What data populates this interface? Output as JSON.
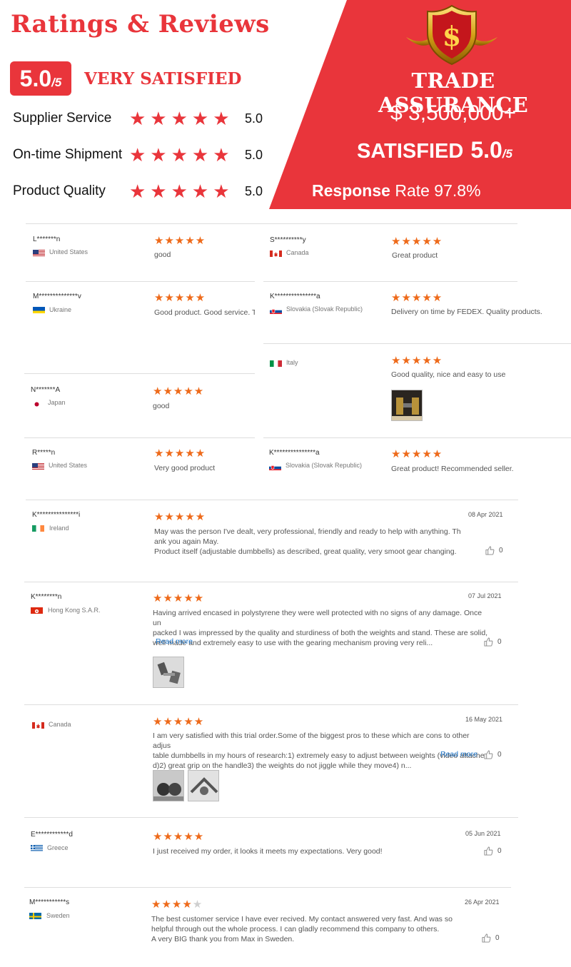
{
  "header": {
    "title": "Ratings & Reviews",
    "score_main": "5.0",
    "score_den": "/5",
    "score_label": "VERY SATISFIED",
    "metrics": [
      {
        "label": "Supplier Service",
        "stars": 5,
        "value": "5.0"
      },
      {
        "label": "On-time Shipment",
        "stars": 5,
        "value": "5.0"
      },
      {
        "label": "Product Quality",
        "stars": 5,
        "value": "5.0"
      }
    ],
    "accent_color": "#e9353b"
  },
  "trade_assurance": {
    "title": "TRADE ASSURANCE",
    "amount": "$ 3,500,000+",
    "satisfied_label": "SATISFIED",
    "satisfied_score": "5.0",
    "satisfied_den": "/5",
    "response_label": "Response",
    "response_rate": "Rate 97.8%",
    "icon": "dollar-shield-icon"
  },
  "reviews": [
    {
      "name": "L*******n",
      "country": "United States",
      "flag": "us",
      "stars": 5,
      "text": "good"
    },
    {
      "name": "S**********y",
      "country": "Canada",
      "flag": "ca",
      "stars": 5,
      "text": "Great product"
    },
    {
      "name": "M**************v",
      "country": "Ukraine",
      "flag": "ua",
      "stars": 5,
      "text": "Good product.  Good service.  T"
    },
    {
      "name": "K***************a",
      "country": "Slovakia (Slovak Republic)",
      "flag": "sk",
      "stars": 5,
      "text": "Delivery on time by FEDEX. Quality products."
    },
    {
      "name": "",
      "country": "Italy",
      "flag": "it",
      "stars": 5,
      "text": "Good quality, nice and easy to use",
      "images": 1
    },
    {
      "name": "N*******A",
      "country": "Japan",
      "flag": "jp",
      "stars": 5,
      "text": "good"
    },
    {
      "name": "R*****n",
      "country": "United States",
      "flag": "us",
      "stars": 5,
      "text": "Very good product"
    },
    {
      "name": "K***************a",
      "country": "Slovakia (Slovak Republic)",
      "flag": "sk",
      "stars": 5,
      "text": "Great product! Recommended seller."
    },
    {
      "name": "K***************i",
      "country": "Ireland",
      "flag": "ie",
      "stars": 5,
      "date": "08 Apr 2021",
      "likes": "0",
      "text": "May was the person I've dealt, very professional, friendly and ready to help with anything. Th\nank you again May.\nProduct itself (adjustable dumbbells) as described, great quality, very smoot gear changing."
    },
    {
      "name": "K********n",
      "country": "Hong Kong S.A.R.",
      "flag": "hk",
      "stars": 5,
      "date": "07 Jul 2021",
      "likes": "0",
      "text": "Having arrived encased in polystyrene they were well protected with no signs of any damage. Once un\npacked I was impressed by the quality and sturdiness of both the weights and stand. These are solid,\nwell made and extremely easy to use with the gearing mechanism proving very reli...",
      "more": "Read more",
      "images": 1
    },
    {
      "name": "",
      "country": "Canada",
      "flag": "ca",
      "stars": 5,
      "date": "16 May 2021",
      "likes": "0",
      "text": "I am very satisfied with this trial order.Some of the biggest pros to these which are cons to other adjus\ntable dumbbells in my hours of research:1) extremely easy to adjust between weights (video attache\nd)2) great grip on the handle3) the weights do not jiggle while they move4) n...",
      "more": "Read more",
      "images": 2
    },
    {
      "name": "E************d",
      "country": "Greece",
      "flag": "gr",
      "stars": 5,
      "date": "05 Jun 2021",
      "likes": "0",
      "text": "I just received my order, it looks it meets my expectations. Very good!"
    },
    {
      "name": "M***********s",
      "country": "Sweden",
      "flag": "se",
      "stars": 4,
      "date": "26 Apr 2021",
      "likes": "0",
      "text": "The best customer service I have ever recived. My contact answered very fast. And was so\nhelpful through out the whole process. I can gladly recommend this company to others.\nA very BIG thank you from Max in Sweden."
    }
  ],
  "colors": {
    "star": "#ee6a1a",
    "link": "#1a73c8",
    "divider": "#dedede"
  }
}
